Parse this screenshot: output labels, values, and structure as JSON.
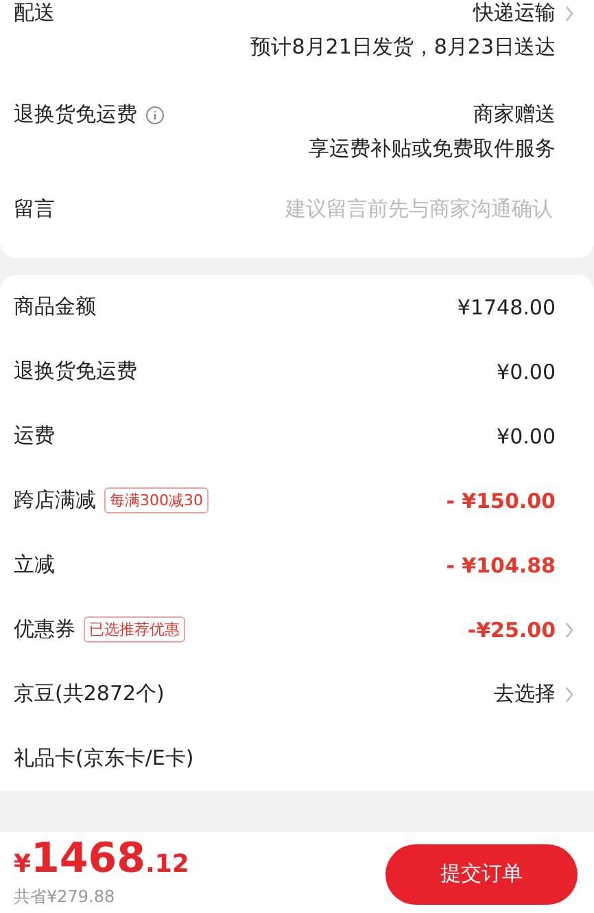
{
  "delivery": {
    "label": "配送",
    "value": "快递运输",
    "note": "预计8月21日发货，8月23日送达"
  },
  "return_shipping": {
    "label": "退换货免运费",
    "value": "商家赠送",
    "note": "享运费补贴或免费取件服务"
  },
  "message": {
    "label": "留言",
    "placeholder": "建议留言前先与商家沟通确认"
  },
  "summary": [
    {
      "label": "商品金额",
      "value": "¥1748.00",
      "kind": "plain",
      "chevron": false
    },
    {
      "label": "退换货免运费",
      "value": "¥0.00",
      "kind": "plain",
      "chevron": false
    },
    {
      "label": "运费",
      "value": "¥0.00",
      "kind": "plain",
      "chevron": false
    },
    {
      "label": "跨店满减",
      "tag": "每满300减30",
      "value": "- ¥150.00",
      "kind": "discount",
      "chevron": false
    },
    {
      "label": "立减",
      "value": "- ¥104.88",
      "kind": "discount",
      "chevron": false
    },
    {
      "label": "优惠券",
      "tag": "已选推荐优惠",
      "value": "-¥25.00",
      "kind": "discount",
      "chevron": true
    },
    {
      "label": "京豆(共2872个)",
      "value": "去选择",
      "kind": "plain",
      "chevron": true
    },
    {
      "label": "礼品卡(京东卡/E卡)",
      "chevron": false
    }
  ],
  "footer": {
    "currency": "¥",
    "price_int": "1468",
    "price_dec": ".12",
    "saved": "共省¥279.88",
    "submit": "提交订单"
  }
}
